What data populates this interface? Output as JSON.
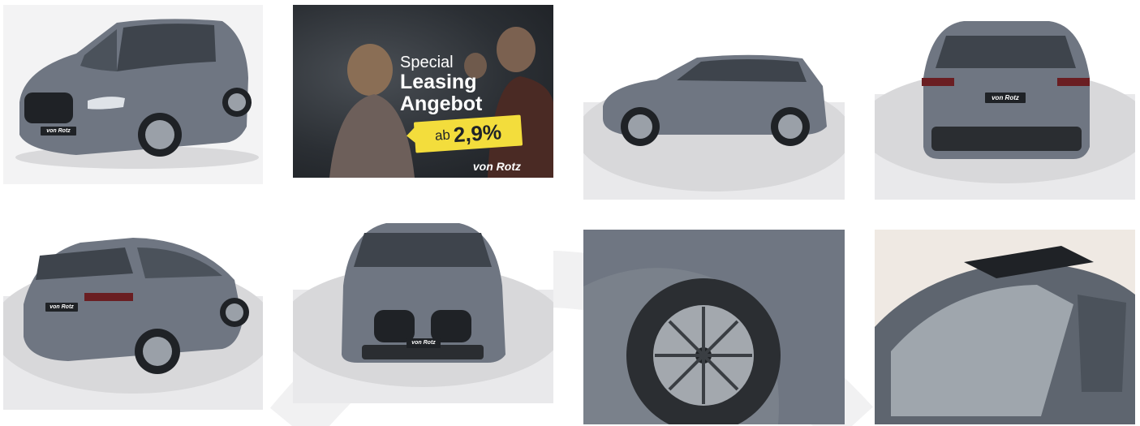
{
  "gallery": {
    "promo": {
      "line1": "Special",
      "line2": "Leasing",
      "line3": "Angebot",
      "badge_prefix": "ab",
      "badge_rate": "2,9%",
      "brand": "von Rotz"
    },
    "plate_text": "von Rotz",
    "colors": {
      "car_body": "#6f7682",
      "car_dark": "#2a2d31",
      "studio_floor": "#d8d8da",
      "badge_yellow": "#f3dd3c"
    }
  }
}
